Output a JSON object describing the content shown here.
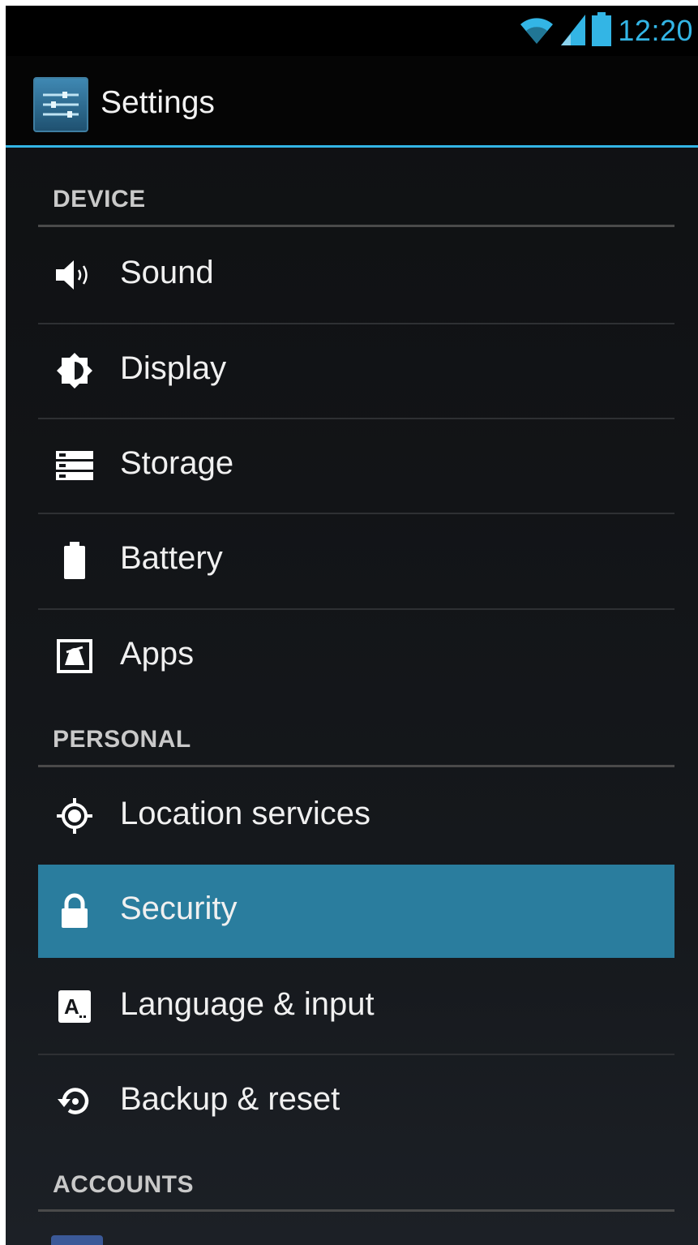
{
  "status_bar": {
    "time": "12:20",
    "icons": [
      "wifi-icon",
      "signal-icon",
      "battery-icon"
    ],
    "accent_color": "#33b5e5"
  },
  "action_bar": {
    "title": "Settings",
    "icon": "settings-sliders-icon"
  },
  "sections": [
    {
      "header": "DEVICE",
      "items": [
        {
          "label": "Sound",
          "icon": "speaker-icon"
        },
        {
          "label": "Display",
          "icon": "brightness-icon"
        },
        {
          "label": "Storage",
          "icon": "storage-icon"
        },
        {
          "label": "Battery",
          "icon": "battery-icon"
        },
        {
          "label": "Apps",
          "icon": "apps-icon"
        }
      ]
    },
    {
      "header": "PERSONAL",
      "items": [
        {
          "label": "Location services",
          "icon": "location-icon"
        },
        {
          "label": "Security",
          "icon": "lock-icon",
          "selected": true
        },
        {
          "label": "Language & input",
          "icon": "keyboard-icon"
        },
        {
          "label": "Backup & reset",
          "icon": "backup-icon"
        }
      ]
    },
    {
      "header": "ACCOUNTS",
      "items": []
    }
  ],
  "colors": {
    "selected_row": "#2a7d9e",
    "background": "#121417"
  }
}
